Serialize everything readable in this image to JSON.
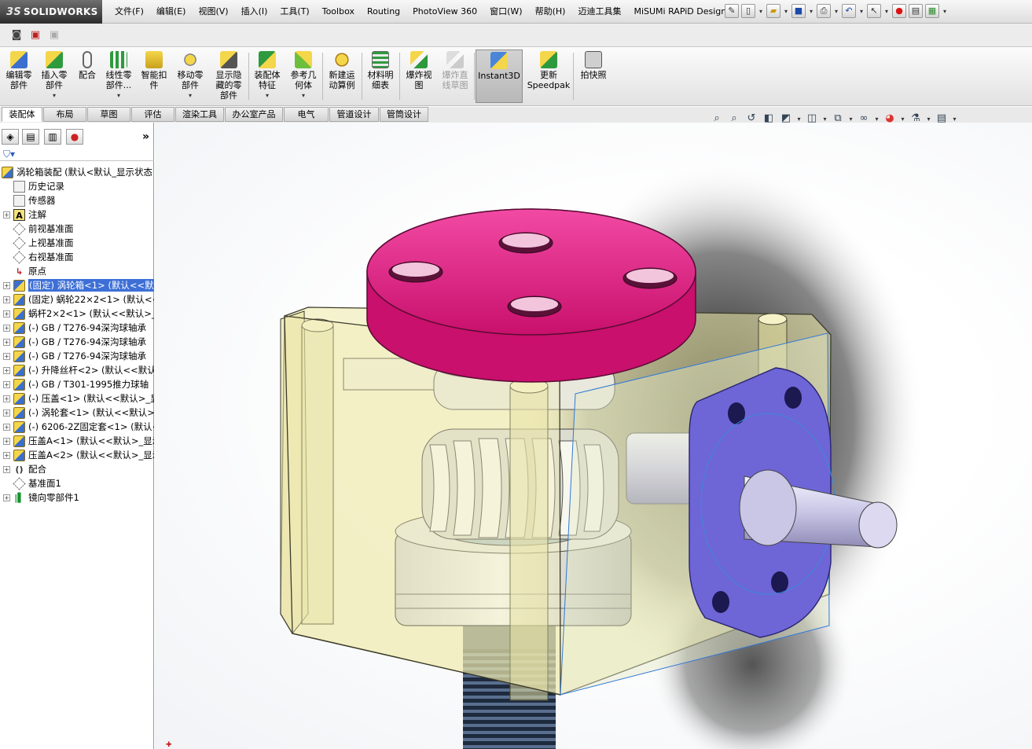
{
  "app": {
    "logo_ds": "3S",
    "logo_text": "SOLIDWORKS"
  },
  "menus": [
    "文件(F)",
    "编辑(E)",
    "视图(V)",
    "插入(I)",
    "工具(T)",
    "Toolbox",
    "Routing",
    "PhotoView 360",
    "窗口(W)",
    "帮助(H)",
    "迈迪工具集",
    "MiSUMi RAPiD Design"
  ],
  "commands": [
    {
      "label": "编辑零\n部件"
    },
    {
      "label": "插入零\n部件"
    },
    {
      "label": "配合"
    },
    {
      "label": "线性零\n部件..."
    },
    {
      "label": "智能扣\n件"
    },
    {
      "label": "移动零\n部件"
    },
    {
      "label": "显示隐\n藏的零\n部件"
    },
    {
      "label": "装配体\n特征"
    },
    {
      "label": "参考几\n何体"
    },
    {
      "label": "新建运\n动算例"
    },
    {
      "label": "材料明\n细表"
    },
    {
      "label": "爆炸视\n图"
    },
    {
      "label": "爆炸直\n线草图"
    },
    {
      "label": "Instant3D"
    },
    {
      "label": "更新\nSpeedpak"
    },
    {
      "label": "拍快照"
    }
  ],
  "tabs": [
    "装配体",
    "布局",
    "草图",
    "评估",
    "渲染工具",
    "办公室产品",
    "电气",
    "管道设计",
    "管筒设计"
  ],
  "tree": {
    "root": "涡轮箱装配 (默认<默认_显示状态",
    "items": [
      {
        "label": "历史记录"
      },
      {
        "label": "传感器"
      },
      {
        "label": "注解"
      },
      {
        "label": "前视基准面"
      },
      {
        "label": "上视基准面"
      },
      {
        "label": "右视基准面"
      },
      {
        "label": "原点"
      },
      {
        "label": "(固定) 涡轮箱<1> (默认<<默认"
      },
      {
        "label": "(固定) 蜗轮22×2<1> (默认<<默"
      },
      {
        "label": "蜗杆2×2<1> (默认<<默认>_显"
      },
      {
        "label": "(-) GB / T276-94深沟球轴承"
      },
      {
        "label": "(-) GB / T276-94深沟球轴承"
      },
      {
        "label": "(-) GB / T276-94深沟球轴承"
      },
      {
        "label": "(-) 升降丝杆<2> (默认<<默认"
      },
      {
        "label": "(-) GB / T301-1995推力球轴"
      },
      {
        "label": "(-) 压盖<1> (默认<<默认>_显"
      },
      {
        "label": "(-) 涡轮套<1> (默认<<默认>"
      },
      {
        "label": "(-) 6206-2Z固定套<1> (默认<"
      },
      {
        "label": "压盖A<1> (默认<<默认>_显示"
      },
      {
        "label": "压盖A<2> (默认<<默认>_显示"
      },
      {
        "label": "配合"
      },
      {
        "label": "基准面1"
      },
      {
        "label": "镜向零部件1"
      }
    ]
  }
}
